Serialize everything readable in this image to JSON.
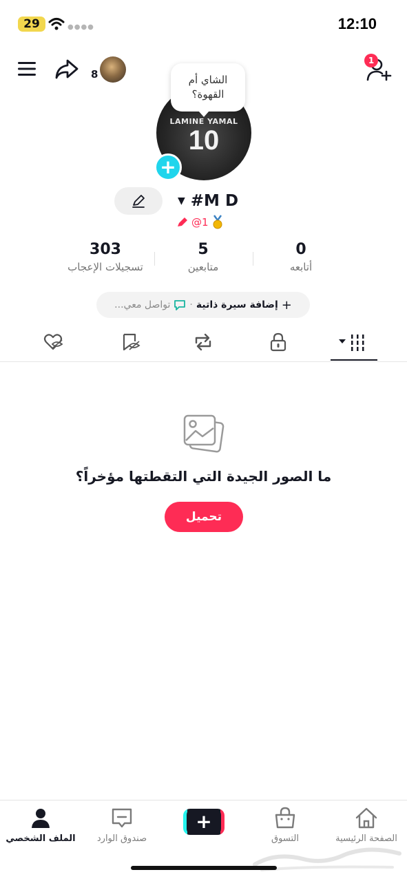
{
  "status_bar": {
    "battery": "29",
    "time": "12:10"
  },
  "top_bar": {
    "visitor_count": "8",
    "friend_requests_badge": "1"
  },
  "profile": {
    "thought_bubble": "الشاي أم القهوة؟",
    "jersey_name": "LAMINE YAMAL",
    "jersey_number": "10",
    "display_name": "#M D",
    "handle": "@1"
  },
  "stats": [
    {
      "key": "following",
      "value": "0",
      "label": "أتابعه"
    },
    {
      "key": "followers",
      "value": "5",
      "label": "متابعين"
    },
    {
      "key": "likes",
      "value": "303",
      "label": "تسجيلات الإعجاب"
    }
  ],
  "bio": {
    "add_bio": "إضافة سيرة ذاتية",
    "separator": "·",
    "contact": "تواصل معي..."
  },
  "tabs": [
    {
      "name": "videos",
      "icon": "grid-icon",
      "active": true
    },
    {
      "name": "private",
      "icon": "lock-icon",
      "active": false
    },
    {
      "name": "reposts",
      "icon": "repost-icon",
      "active": false
    },
    {
      "name": "favorites",
      "icon": "bookmark-hidden-icon",
      "active": false
    },
    {
      "name": "liked",
      "icon": "heart-hidden-icon",
      "active": false
    }
  ],
  "empty_state": {
    "title": "ما الصور الجيدة التي التقطتها مؤخراً؟",
    "button": "تحميل"
  },
  "bottom_nav": [
    {
      "key": "profile",
      "label": "الملف الشخصي",
      "icon": "person-icon",
      "active": true
    },
    {
      "key": "inbox",
      "label": "صندوق الوارد",
      "icon": "inbox-icon",
      "active": false
    },
    {
      "key": "create",
      "label": "",
      "icon": "plus-icon",
      "active": false
    },
    {
      "key": "shop",
      "label": "التسوق",
      "icon": "shopping-bag-icon",
      "active": false
    },
    {
      "key": "home",
      "label": "الصفحة الرئيسية",
      "icon": "home-icon",
      "active": false
    }
  ],
  "colors": {
    "accent": "#fe2c55",
    "cyan": "#20d5ec",
    "text": "#161823"
  }
}
